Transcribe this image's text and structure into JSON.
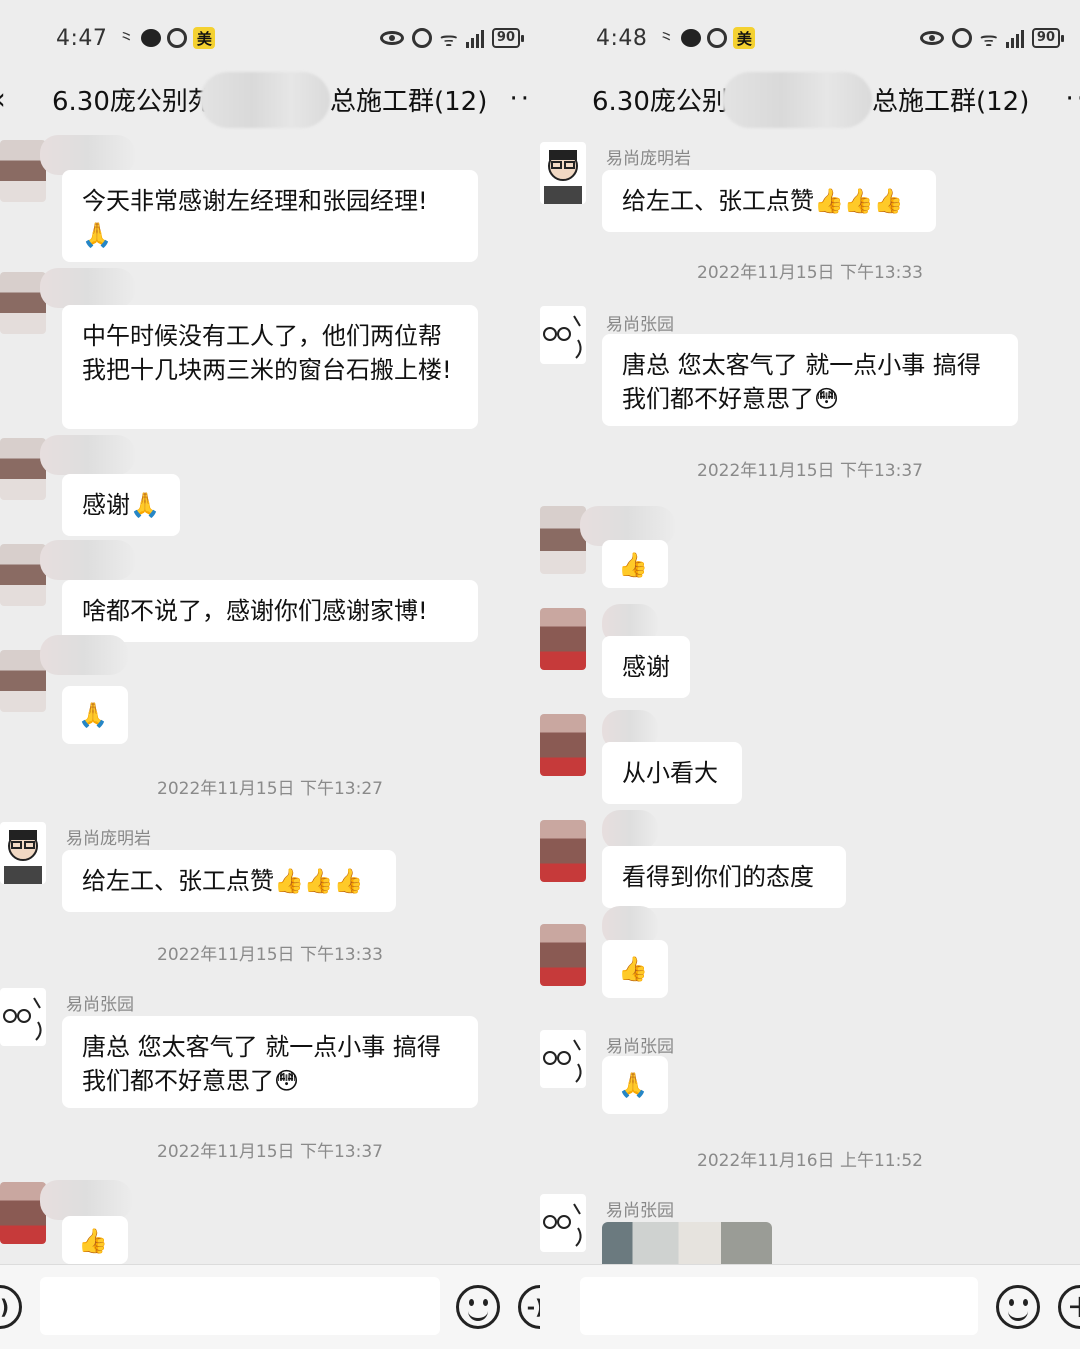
{
  "left": {
    "status": {
      "time": "4:47",
      "battery": "90"
    },
    "header": {
      "title": "6.30庞公别苑",
      "suffix": "总施工群(12)"
    },
    "messages": [
      {
        "text": "今天非常感谢左经理和张园经理!",
        "emoji": "🙏"
      },
      {
        "text": "中午时候没有工人了，他们两位帮我把十几块两三米的窗台石搬上楼!"
      },
      {
        "text": "感谢🙏"
      },
      {
        "text": "啥都不说了，感谢你们感谢家博!"
      },
      {
        "emoji": "🙏"
      },
      {
        "timestamp": "2022年11月15日 下午13:27"
      },
      {
        "sender": "易尚庞明岩",
        "text": "给左工、张工点赞👍👍👍"
      },
      {
        "timestamp": "2022年11月15日 下午13:33"
      },
      {
        "sender": "易尚张园",
        "text": "唐总 您太客气了 就一点小事 搞得我们都不好意思了😳"
      },
      {
        "timestamp": "2022年11月15日 下午13:37"
      },
      {
        "emoji": "👍"
      }
    ]
  },
  "right": {
    "status": {
      "time": "4:48",
      "battery": "90"
    },
    "header": {
      "title": "6.30庞公别",
      "suffix": "总施工群(12)"
    },
    "messages": [
      {
        "sender": "易尚庞明岩",
        "text": "给左工、张工点赞👍👍👍"
      },
      {
        "timestamp": "2022年11月15日 下午13:33"
      },
      {
        "sender": "易尚张园",
        "text": "唐总 您太客气了 就一点小事 搞得我们都不好意思了😳"
      },
      {
        "timestamp": "2022年11月15日 下午13:37"
      },
      {
        "emoji": "👍"
      },
      {
        "text": "感谢"
      },
      {
        "text": "从小看大"
      },
      {
        "text": "看得到你们的态度"
      },
      {
        "emoji": "👍"
      },
      {
        "sender": "易尚张园",
        "emoji": "🙏"
      },
      {
        "timestamp": "2022年11月16日 上午11:52"
      },
      {
        "sender": "易尚张园"
      }
    ]
  },
  "icons": {
    "status_mei": "美",
    "back": "back-chevron-icon",
    "more": "more-dots-icon",
    "voice": "voice-icon",
    "emoji": "emoji-icon",
    "plus": "plus-icon"
  }
}
